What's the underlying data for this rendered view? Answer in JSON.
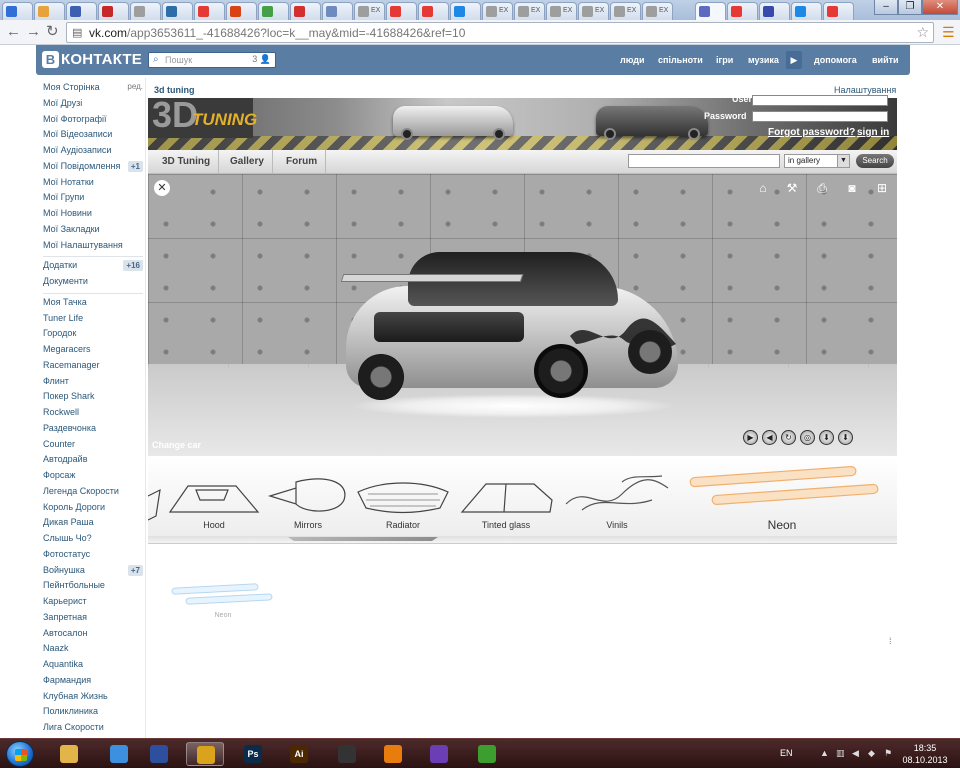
{
  "browser": {
    "url_host": "vk.com",
    "url_path": "/app3653611_-41688426?loc=k__may&mid=-41688426&ref=10",
    "tabs": [
      {
        "label": "",
        "color": "#2f6fd6"
      },
      {
        "label": "",
        "color": "#e8a23a"
      },
      {
        "label": "",
        "color": "#3c5fb0"
      },
      {
        "label": "",
        "color": "#c62828"
      },
      {
        "label": "",
        "color": "#9e9e9e"
      },
      {
        "label": "",
        "color": "#2d6ea8"
      },
      {
        "label": "",
        "color": "#e53935"
      },
      {
        "label": "",
        "color": "#d84315"
      },
      {
        "label": "",
        "color": "#43a047"
      },
      {
        "label": "",
        "color": "#d32f2f"
      },
      {
        "label": "",
        "color": "#6d8bbf"
      },
      {
        "label": "EX",
        "color": "#9e9e9e"
      },
      {
        "label": "",
        "color": "#e53935"
      },
      {
        "label": "",
        "color": "#e53935"
      },
      {
        "label": "",
        "color": "#1e88e5"
      },
      {
        "label": "EX",
        "color": "#9e9e9e"
      },
      {
        "label": "EX",
        "color": "#9e9e9e"
      },
      {
        "label": "EX",
        "color": "#9e9e9e"
      },
      {
        "label": "EX",
        "color": "#9e9e9e"
      },
      {
        "label": "EX",
        "color": "#9e9e9e"
      },
      {
        "label": "EX",
        "color": "#9e9e9e"
      },
      {
        "label": "",
        "color": "#5c6bc0"
      },
      {
        "label": "",
        "color": "#e53935"
      },
      {
        "label": "",
        "color": "#3949ab"
      },
      {
        "label": "",
        "color": "#1e88e5"
      },
      {
        "label": "",
        "color": "#e53935"
      }
    ],
    "window_buttons": {
      "minimize": "–",
      "maximize": "❐",
      "close": "✕"
    },
    "nav_icons": {
      "back": "back-arrow-icon",
      "forward": "forward-arrow-icon",
      "reload": "reload-icon"
    }
  },
  "vk": {
    "logo_letter": "В",
    "logo_text": "КОНТАКТЕ",
    "search_placeholder": "Пошук",
    "search_count": "3",
    "nav": [
      "люди",
      "спільноти",
      "ігри",
      "музика",
      "допомога",
      "вийти"
    ],
    "left_menu_main": [
      {
        "label": "Моя Сторінка",
        "extra": "ред."
      },
      {
        "label": "Мої Друзі"
      },
      {
        "label": "Мої Фотографії"
      },
      {
        "label": "Мої Відеозаписи"
      },
      {
        "label": "Мої Аудіозаписи"
      },
      {
        "label": "Мої Повідомлення",
        "badge": "+1"
      },
      {
        "label": "Мої Нотатки"
      },
      {
        "label": "Мої Групи"
      },
      {
        "label": "Мої Новини"
      },
      {
        "label": "Мої Закладки"
      },
      {
        "label": "Мої Налаштування"
      }
    ],
    "left_menu_apps": [
      {
        "label": "Додатки",
        "badge": "+16"
      },
      {
        "label": "Документи"
      }
    ],
    "left_menu_games": [
      {
        "label": "Моя Тачка"
      },
      {
        "label": "Tuner Life"
      },
      {
        "label": "Городок"
      },
      {
        "label": "Megaracers"
      },
      {
        "label": "Racemanager"
      },
      {
        "label": "Флинт"
      },
      {
        "label": "Покер Shark"
      },
      {
        "label": "Rockwell"
      },
      {
        "label": "Раздевчонка"
      },
      {
        "label": "Counter"
      },
      {
        "label": "Автодрайв"
      },
      {
        "label": "Форсаж"
      },
      {
        "label": "Легенда Скорости"
      },
      {
        "label": "Король Дороги"
      },
      {
        "label": "Дикая Раша"
      },
      {
        "label": "Слышь Чо?"
      },
      {
        "label": "Фотостатус"
      },
      {
        "label": "Войнушка",
        "badge": "+7"
      },
      {
        "label": "Пейнтбольные"
      },
      {
        "label": "Карьерист"
      },
      {
        "label": "Запретная"
      },
      {
        "label": "Автосалон"
      },
      {
        "label": "Naazk"
      },
      {
        "label": "Aquantika"
      },
      {
        "label": "Фармандия"
      },
      {
        "label": "Клубная Жизнь"
      },
      {
        "label": "Поликлиника"
      },
      {
        "label": "Лига Скорости"
      }
    ]
  },
  "app": {
    "title": "3d tuning",
    "settings_link": "Налаштування",
    "banner_logo_3d": "3D",
    "banner_logo_tuning": "TUNING",
    "login_label": "User",
    "password_label": "Password",
    "forgot_link": "Forgot password?",
    "signin_link": "sign in",
    "tabs": [
      "3D Tuning",
      "Gallery",
      "Forum"
    ],
    "search_value": "",
    "search_scope": "in gallery",
    "search_button": "Search",
    "change_car": "Change car",
    "view_icons": [
      "home-icon",
      "tuning-icon",
      "printer-icon",
      "camera-icon",
      "network-icon"
    ],
    "control_buttons": [
      "▶",
      "◀",
      "↻",
      "◎",
      "⬇",
      "⬇"
    ],
    "parts": [
      "Hood",
      "Mirrors",
      "Radiator",
      "Tinted glass",
      "Vinils",
      "Neon"
    ],
    "selected_part": "Neon",
    "thumb_label": "Neon"
  },
  "taskbar": {
    "apps": [
      {
        "icon": "folder-icon",
        "text": "",
        "color": "#e2b44a"
      },
      {
        "icon": "dropbox-icon",
        "text": "",
        "color": "#3d8fe0"
      },
      {
        "icon": "save-icon",
        "text": "",
        "color": "#2e4f9e"
      },
      {
        "icon": "chrome-icon",
        "text": "",
        "color": "#d9a31c",
        "active": true
      },
      {
        "icon": "photoshop-icon",
        "text": "Ps",
        "color": "#0b2b4a"
      },
      {
        "icon": "illustrator-icon",
        "text": "Ai",
        "color": "#4b2800"
      },
      {
        "icon": "unity-icon",
        "text": "",
        "color": "#333333"
      },
      {
        "icon": "blender-icon",
        "text": "",
        "color": "#e87d0d"
      },
      {
        "icon": "infinity-icon",
        "text": "",
        "color": "#6a3fb5"
      },
      {
        "icon": "utorrent-icon",
        "text": "",
        "color": "#3d9e2f"
      }
    ],
    "language": "EN",
    "time": "18:35",
    "date": "08.10.2013"
  }
}
